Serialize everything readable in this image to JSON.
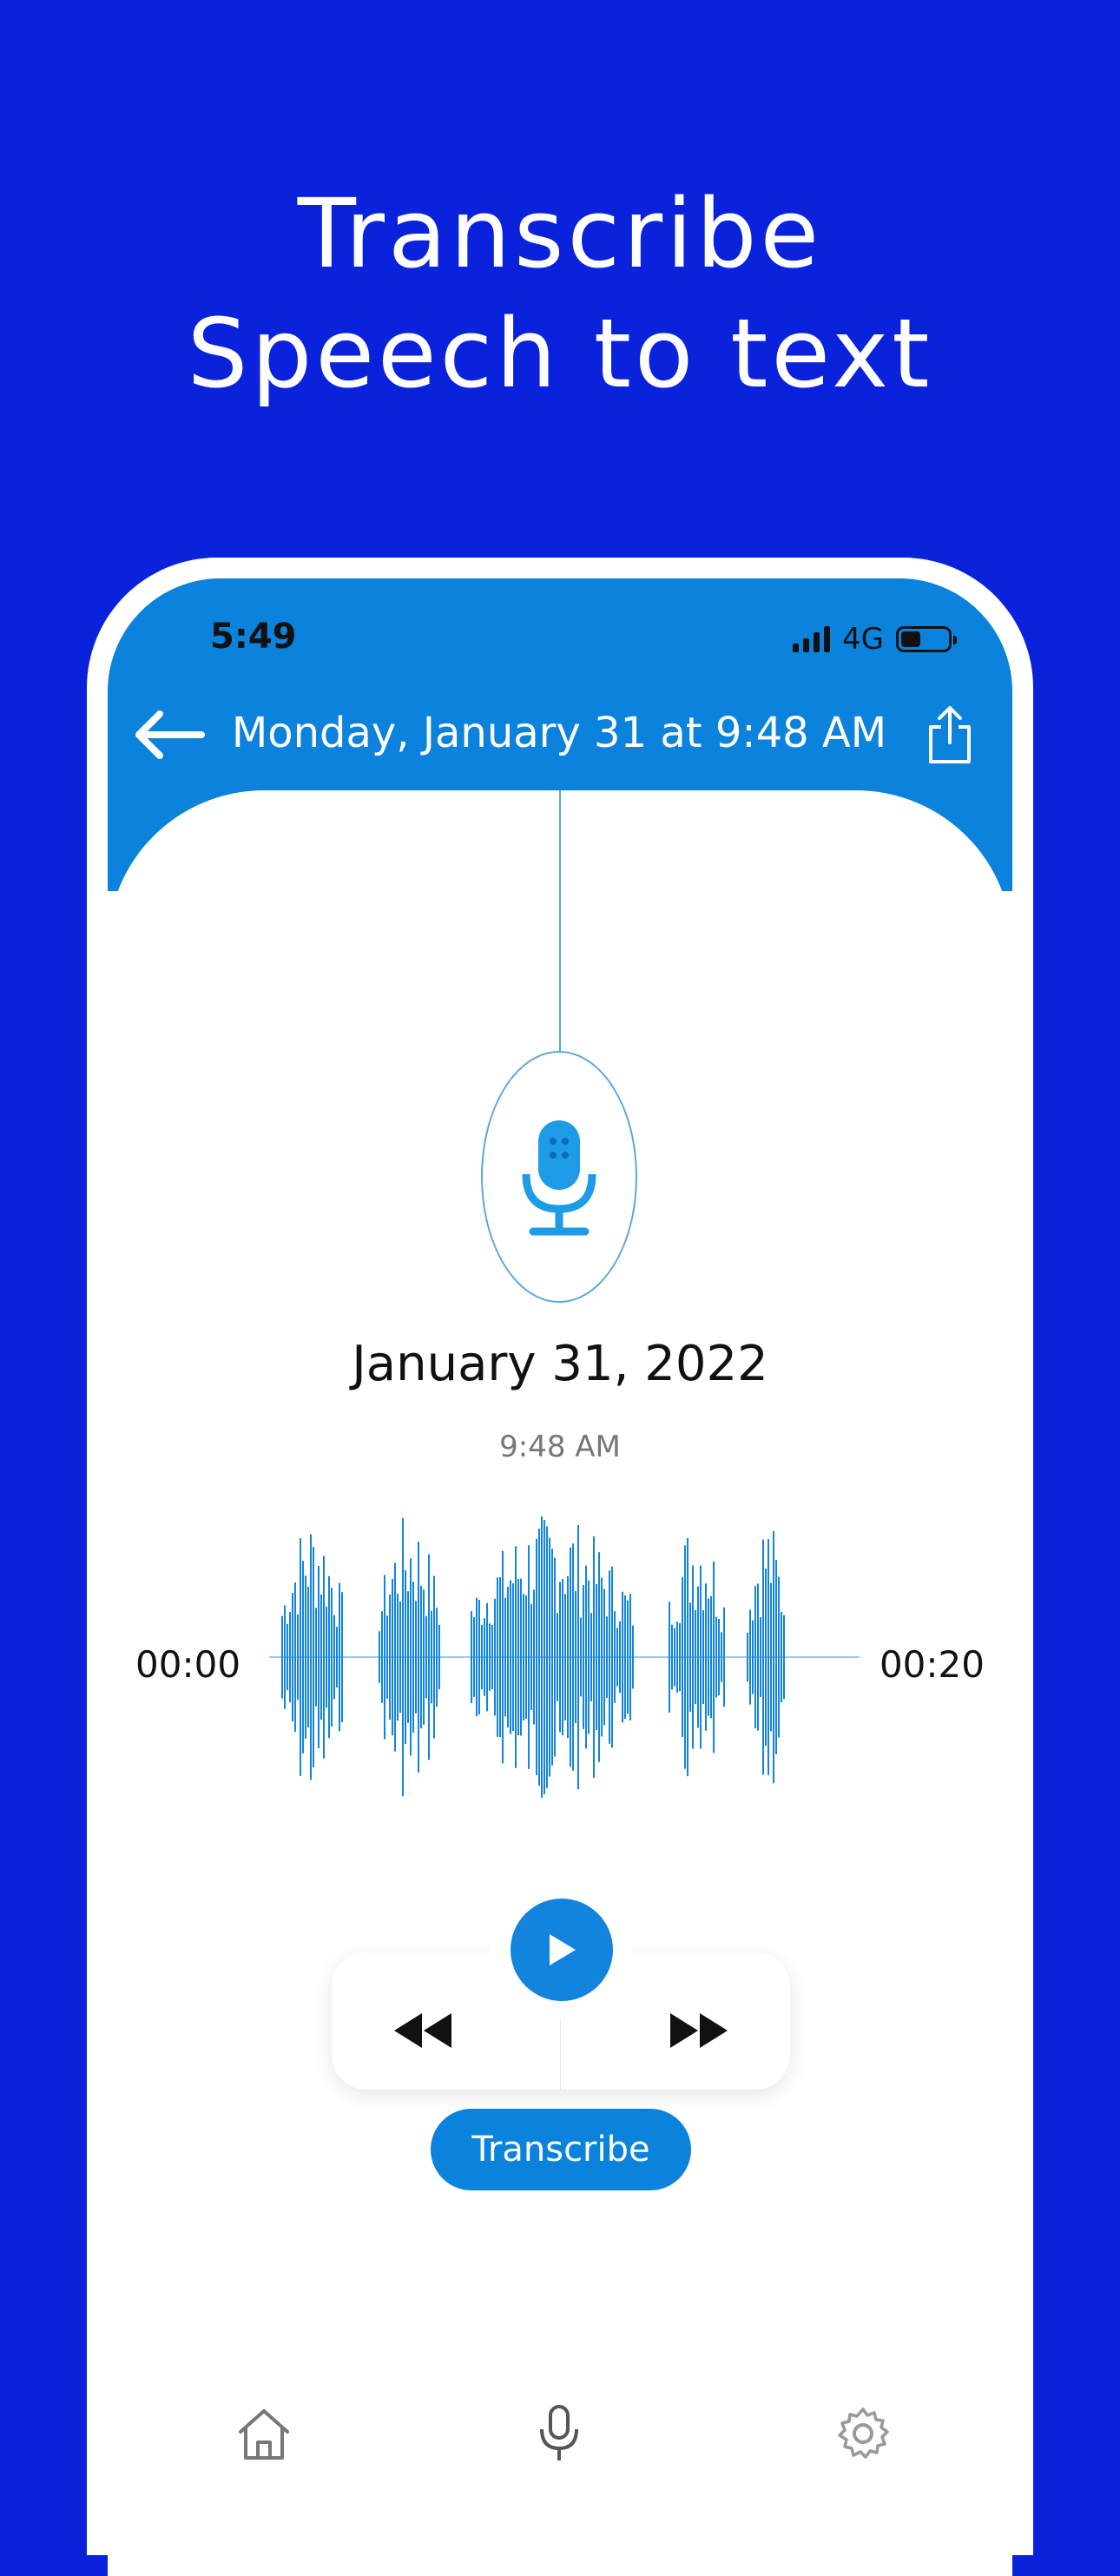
{
  "promo": {
    "title_line1": "Transcribe",
    "title_line2": "Speech to text"
  },
  "status_bar": {
    "time": "5:49",
    "network": "4G",
    "icons": [
      "signal-icon",
      "battery-icon"
    ]
  },
  "header": {
    "title": "Monday, January 31 at 9:48 AM",
    "back_icon": "back-arrow-icon",
    "share_icon": "share-icon"
  },
  "recording": {
    "date": "January 31, 2022",
    "time": "9:48 AM",
    "start_time": "00:00",
    "end_time": "00:20",
    "icon": "microphone-icon"
  },
  "controls": {
    "play_icon": "play-icon",
    "rewind_icon": "rewind-icon",
    "forward_icon": "fast-forward-icon"
  },
  "transcribe_label": "Transcribe",
  "tab_bar": {
    "items": [
      "home-icon",
      "microphone-icon",
      "gear-icon"
    ]
  },
  "colors": {
    "background": "#0a22dc",
    "accent": "#0b82db",
    "waveform": "#1384dd"
  }
}
